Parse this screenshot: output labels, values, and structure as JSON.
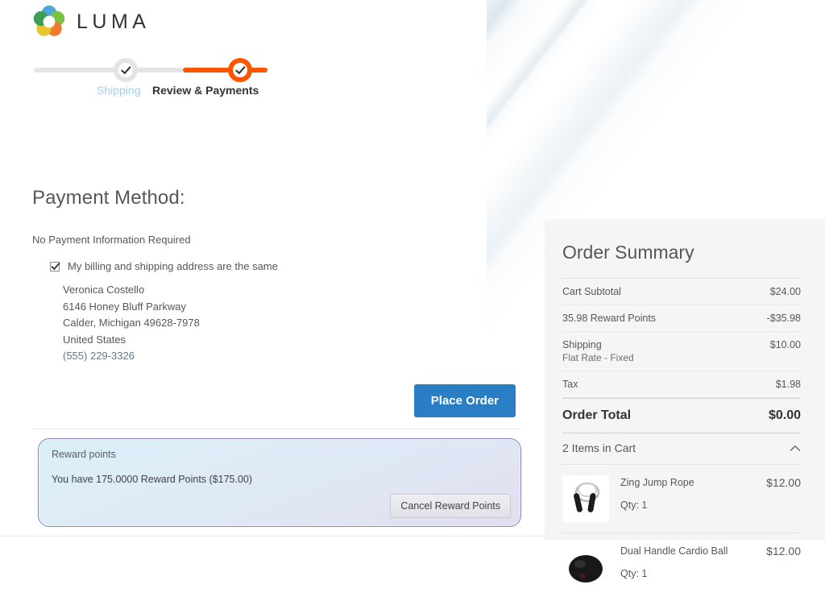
{
  "brand": {
    "name": "LUMA",
    "logo_icon": "luma-circles-logo"
  },
  "progress": {
    "steps": [
      {
        "label": "Shipping",
        "state": "completed",
        "icon": "check-icon"
      },
      {
        "label": "Review & Payments",
        "state": "active",
        "icon": "check-icon"
      }
    ],
    "active_color": "#ff5501",
    "inactive_color": "#e4e4e4"
  },
  "payment": {
    "title": "Payment Method:",
    "no_payment_note": "No Payment Information Required",
    "billing_same_label": "My billing and shipping address are the same",
    "billing_same_checked": true,
    "address": {
      "name": "Veronica Costello",
      "street": "6146 Honey Bluff Parkway",
      "city_state_zip": "Calder, Michigan 49628-7978",
      "country": "United States",
      "phone": "(555) 229-3326"
    },
    "place_order_label": "Place Order",
    "place_order_color": "#2a7fc4"
  },
  "reward": {
    "title": "Reward points",
    "message": "You have 175.0000 Reward Points ($175.00)",
    "cancel_label": "Cancel Reward Points",
    "border_color": "#8a7fc4"
  },
  "summary": {
    "title": "Order Summary",
    "rows": [
      {
        "label": "Cart Subtotal",
        "sub": "",
        "value": "$24.00"
      },
      {
        "label": "35.98 Reward Points",
        "sub": "",
        "value": "-$35.98"
      },
      {
        "label": "Shipping",
        "sub": "Flat Rate - Fixed",
        "value": "$10.00"
      },
      {
        "label": "Tax",
        "sub": "",
        "value": "$1.98"
      }
    ],
    "grand_total": {
      "label": "Order Total",
      "value": "$0.00"
    },
    "items_header": "2 Items in Cart",
    "items_toggle_icon": "chevron-up-icon",
    "items": [
      {
        "name": "Zing Jump Rope",
        "qty": "Qty: 1",
        "price": "$12.00",
        "image": "jump-rope-thumbnail"
      },
      {
        "name": "Dual Handle Cardio Ball",
        "qty": "Qty: 1",
        "price": "$12.00",
        "image": "cardio-ball-thumbnail"
      }
    ]
  }
}
